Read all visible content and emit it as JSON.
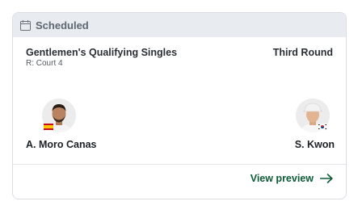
{
  "status": {
    "label": "Scheduled",
    "icon": "calendar-icon"
  },
  "match": {
    "event": "Gentlemen's Qualifying Singles",
    "court": "R: Court 4",
    "round": "Third Round"
  },
  "players": [
    {
      "name": "A. Moro Canas",
      "flag": "spain-flag-icon"
    },
    {
      "name": "S. Kwon",
      "flag": "south-korea-flag-icon"
    }
  ],
  "footer": {
    "preview_label": "View preview",
    "icon": "arrow-right-icon"
  },
  "colors": {
    "status_bar_bg": "#e8ebf0",
    "accent_green": "#0b5b36",
    "text_dark": "#2a2f35"
  }
}
